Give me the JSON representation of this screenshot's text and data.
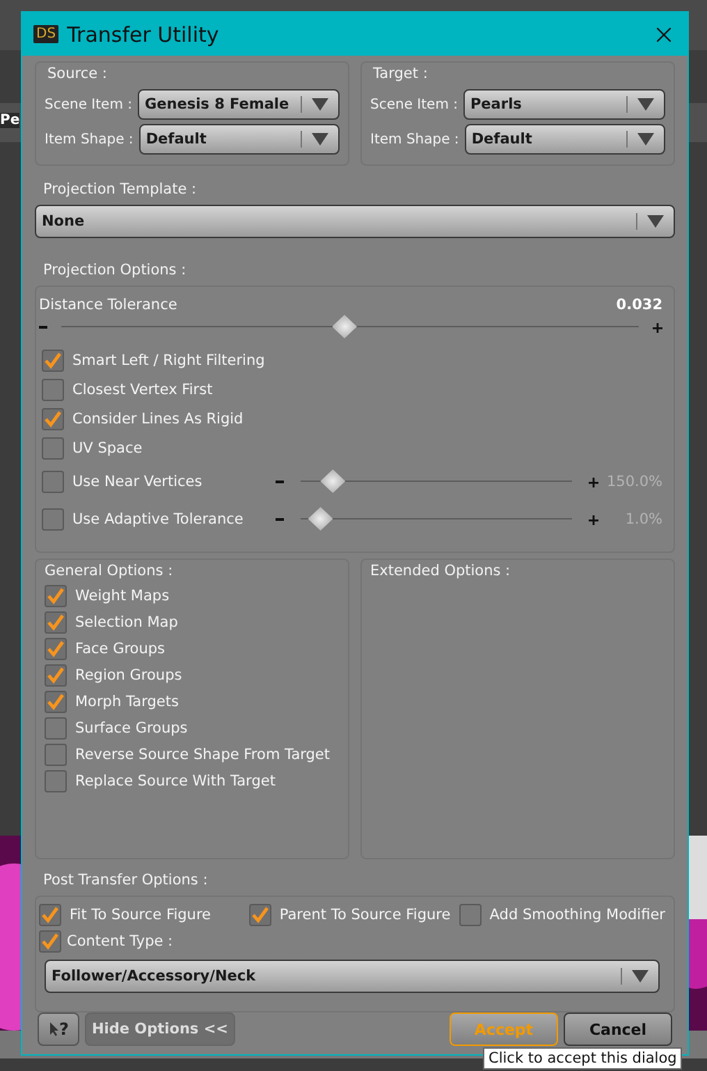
{
  "background": {
    "tab_text": "Pe"
  },
  "window": {
    "title": "Transfer Utility",
    "logo": "DS"
  },
  "source": {
    "heading": "Source :",
    "fields": [
      {
        "label": "Scene Item :",
        "value": "Genesis 8 Female"
      },
      {
        "label": "Item Shape :",
        "value": "Default"
      }
    ]
  },
  "target": {
    "heading": "Target :",
    "fields": [
      {
        "label": "Scene Item :",
        "value": "Pearls"
      },
      {
        "label": "Item Shape :",
        "value": "Default"
      }
    ]
  },
  "projection_template": {
    "heading": "Projection Template :",
    "value": "None"
  },
  "projection_options": {
    "heading": "Projection Options :",
    "distance": {
      "label": "Distance Tolerance",
      "reading": "0.032",
      "level": 0.49
    },
    "options": [
      {
        "kind": "checkbox",
        "label": "Smart Left / Right Filtering",
        "checked": true
      },
      {
        "kind": "checkbox",
        "label": "Closest Vertex First",
        "checked": false
      },
      {
        "kind": "checkbox",
        "label": "Consider Lines As Rigid",
        "checked": true
      },
      {
        "kind": "checkbox",
        "label": "UV Space",
        "checked": false
      },
      {
        "kind": "slider",
        "label": "Use Near Vertices",
        "checked": false,
        "level": 0.08,
        "reading": "150.0%"
      },
      {
        "kind": "slider",
        "label": "Use Adaptive Tolerance",
        "checked": false,
        "level": 0.03,
        "reading": "1.0%"
      }
    ]
  },
  "general_options": {
    "heading": "General Options :",
    "items": [
      {
        "label": "Weight Maps",
        "checked": true
      },
      {
        "label": "Selection Map",
        "checked": true
      },
      {
        "label": "Face Groups",
        "checked": true
      },
      {
        "label": "Region Groups",
        "checked": true
      },
      {
        "label": "Morph Targets",
        "checked": true
      },
      {
        "label": "Surface Groups",
        "checked": false
      },
      {
        "label": "Reverse Source Shape From Target",
        "checked": false
      },
      {
        "label": "Replace Source With Target",
        "checked": false
      }
    ]
  },
  "extended_options": {
    "heading": "Extended Options :"
  },
  "post_transfer": {
    "heading": "Post Transfer Options :",
    "options": [
      {
        "label": "Fit To Source Figure",
        "checked": true
      },
      {
        "label": "Parent To Source Figure",
        "checked": true
      },
      {
        "label": "Add Smoothing Modifier",
        "checked": false
      }
    ],
    "content_type": {
      "label": "Content Type :",
      "checked": true,
      "value": "Follower/Accessory/Neck"
    }
  },
  "footer": {
    "help": "?",
    "toggle": "Hide Options <<",
    "buttons": [
      {
        "label": "Accept",
        "focused": true
      },
      {
        "label": "Cancel",
        "focused": false
      }
    ]
  },
  "tooltip": "Click to accept this dialog"
}
